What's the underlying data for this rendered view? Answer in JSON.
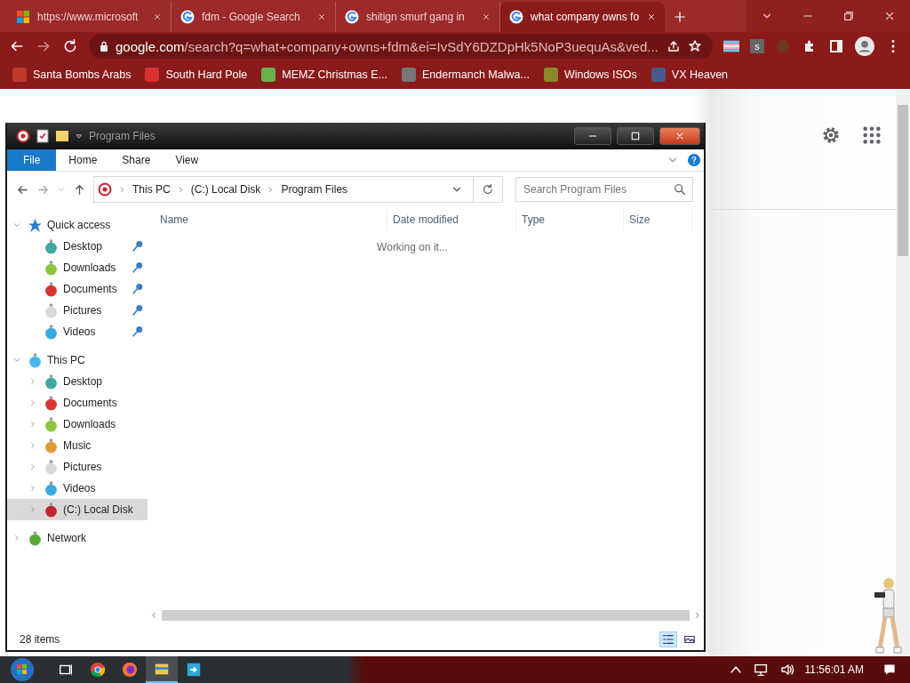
{
  "browser": {
    "tabs": [
      {
        "title": "https://www.microsoft",
        "selected": false,
        "kind": "windows"
      },
      {
        "title": "fdm - Google Search",
        "selected": false,
        "kind": "google"
      },
      {
        "title": "shitign smurf gang in",
        "selected": false,
        "kind": "google"
      },
      {
        "title": "what company owns fo",
        "selected": true,
        "kind": "google"
      }
    ],
    "address": {
      "host": "google.com",
      "path": "/search?q=what+company+owns+fdm&ei=IvSdY6DZDpHk5NoP3uequAs&ved..."
    },
    "extension_badge": "s",
    "bookmarks": [
      {
        "label": "Santa Bombs Arabs",
        "color": "#c0392b"
      },
      {
        "label": "South Hard Pole",
        "color": "#d63031"
      },
      {
        "label": "MEMZ Christmas E...",
        "color": "#6ab04c"
      },
      {
        "label": "Endermanch Malwa...",
        "color": "#777777"
      },
      {
        "label": "Windows ISOs",
        "color": "#8a8a2a"
      },
      {
        "label": "VX Heaven",
        "color": "#4a5a8a"
      }
    ]
  },
  "explorer": {
    "title": "Program Files",
    "ribbon_tabs": [
      {
        "label": "File",
        "kind": "file",
        "selected": false
      },
      {
        "label": "Home",
        "kind": "tab",
        "selected": false
      },
      {
        "label": "Share",
        "kind": "tab",
        "selected": false
      },
      {
        "label": "View",
        "kind": "tab",
        "selected": false
      }
    ],
    "breadcrumb": [
      "This PC",
      "(C:) Local Disk",
      "Program Files"
    ],
    "search": {
      "placeholder": "Search Program Files"
    },
    "columns": [
      "Name",
      "Date modified",
      "Type",
      "Size"
    ],
    "message": "Working on it...",
    "nav": [
      {
        "label": "Quick access",
        "kind": "star",
        "color": "#2b7cd3",
        "expanded": true,
        "selected": false,
        "children": [
          {
            "label": "Desktop",
            "kind": "ball",
            "color": "#3fa7a0",
            "pinned": true,
            "selected": false
          },
          {
            "label": "Downloads",
            "kind": "ball",
            "color": "#8cc63f",
            "pinned": true,
            "selected": false
          },
          {
            "label": "Documents",
            "kind": "ball",
            "color": "#d9352f",
            "pinned": true,
            "selected": false
          },
          {
            "label": "Pictures",
            "kind": "ball",
            "color": "#d8d8d8",
            "pinned": true,
            "selected": false
          },
          {
            "label": "Videos",
            "kind": "ball",
            "color": "#3aa9e0",
            "pinned": true,
            "selected": false
          }
        ]
      },
      {
        "label": "This PC",
        "kind": "ball",
        "color": "#45b8e8",
        "expanded": true,
        "selected": false,
        "children": [
          {
            "label": "Desktop",
            "kind": "ball",
            "color": "#3fa7a0",
            "expanded": false,
            "selected": false
          },
          {
            "label": "Documents",
            "kind": "ball",
            "color": "#d9352f",
            "expanded": false,
            "selected": false
          },
          {
            "label": "Downloads",
            "kind": "ball",
            "color": "#8cc63f",
            "expanded": false,
            "selected": false
          },
          {
            "label": "Music",
            "kind": "ball",
            "color": "#e09a3a",
            "expanded": false,
            "selected": false
          },
          {
            "label": "Pictures",
            "kind": "ball",
            "color": "#d8d8d8",
            "expanded": false,
            "selected": false
          },
          {
            "label": "Videos",
            "kind": "ball",
            "color": "#3aa9e0",
            "expanded": false,
            "selected": false
          },
          {
            "label": "(C:) Local Disk",
            "kind": "ball",
            "color": "#c0282d",
            "expanded": false,
            "selected": true
          }
        ]
      },
      {
        "label": "Network",
        "kind": "ball",
        "color": "#5aa83a",
        "expanded": false,
        "selected": false
      }
    ],
    "status_bar": "28 items",
    "views": [
      {
        "kind": "details",
        "selected": true
      },
      {
        "kind": "thumbnails",
        "selected": false
      }
    ]
  },
  "taskbar": {
    "apps": [
      {
        "kind": "taskview",
        "selected": false
      },
      {
        "kind": "chrome",
        "selected": false
      },
      {
        "kind": "firefox",
        "selected": false
      },
      {
        "kind": "explorer",
        "selected": true
      },
      {
        "kind": "remote",
        "selected": false
      }
    ],
    "clock": "11:56:01 AM"
  }
}
